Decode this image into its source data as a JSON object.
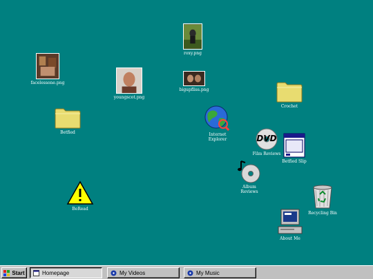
{
  "desktop": {
    "background": "#008080",
    "icons": {
      "roxy": {
        "label": "roxy.png"
      },
      "facelessone": {
        "label": "facelessone.png"
      },
      "youngscot": {
        "label": "youngscot.png"
      },
      "bigupfliss": {
        "label": "bigupfliss.png"
      },
      "crochet": {
        "label": "Crochet"
      },
      "betfied": {
        "label": "Betfied"
      },
      "internet_explorer": {
        "label": "Internet\nExplorer"
      },
      "film_reviews": {
        "label": "Film Reviews"
      },
      "betfied_slip": {
        "label": "Betfied Slip"
      },
      "album_reviews": {
        "label": "Album\nReviews"
      },
      "beread": {
        "label": "BeRead"
      },
      "recycling_bin": {
        "label": "Recycling Bin"
      },
      "about_me": {
        "label": "About Me"
      }
    }
  },
  "taskbar": {
    "start_label": "Start",
    "tasks": [
      {
        "label": "Homepage",
        "active": true,
        "icon": "page-icon"
      },
      {
        "label": "My Videos",
        "active": false,
        "icon": "disc-icon"
      },
      {
        "label": "My Music",
        "active": false,
        "icon": "disc-icon"
      }
    ]
  }
}
